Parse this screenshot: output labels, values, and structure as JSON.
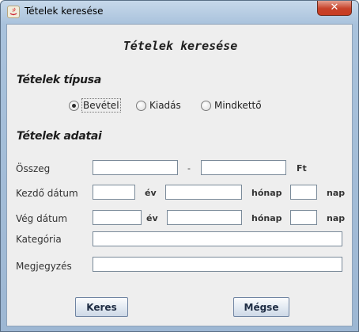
{
  "window": {
    "title": "Tételek keresése",
    "close_label": "✕"
  },
  "heading": "Tételek keresése",
  "type_section": {
    "title": "Tételek típusa",
    "options": [
      {
        "label": "Bevétel",
        "selected": true
      },
      {
        "label": "Kiadás",
        "selected": false
      },
      {
        "label": "Mindkettő",
        "selected": false
      }
    ]
  },
  "data_section": {
    "title": "Tételek adatai",
    "amount": {
      "label": "Összeg",
      "separator": "-",
      "unit": "Ft",
      "from_value": "",
      "to_value": ""
    },
    "start_date": {
      "label": "Kezdő dátum",
      "year_unit": "év",
      "month_unit": "hónap",
      "day_unit": "nap",
      "year": "",
      "month": "",
      "day": ""
    },
    "end_date": {
      "label": "Vég dátum",
      "year_unit": "év",
      "month_unit": "hónap",
      "day_unit": "nap",
      "year": "",
      "month": "",
      "day": ""
    },
    "category": {
      "label": "Kategória",
      "value": ""
    },
    "note": {
      "label": "Megjegyzés",
      "value": ""
    }
  },
  "buttons": {
    "search": "Keres",
    "cancel": "Mégse"
  },
  "colors": {
    "titlebar": "#a9c2dc",
    "panel": "#eeeeee",
    "close": "#c7422a"
  }
}
